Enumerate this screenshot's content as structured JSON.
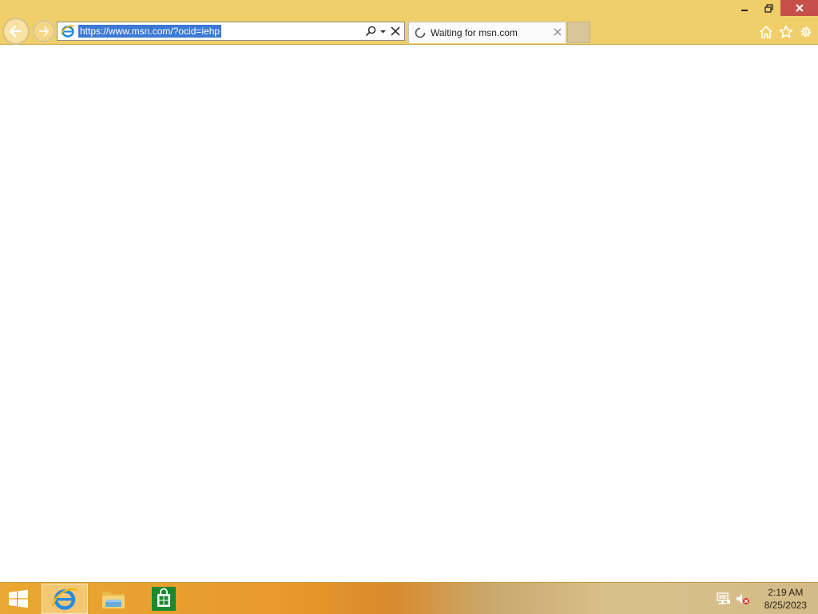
{
  "browser": {
    "address_url": "https://www.msn.com/?ocid=iehp",
    "tab_title": "Waiting for msn.com",
    "chrome_color": "#f0cf6b"
  },
  "icons": {
    "back": "back-arrow-icon",
    "forward": "forward-arrow-icon",
    "ie": "internet-explorer-icon",
    "search": "search-icon",
    "dropdown": "chevron-down-icon",
    "stop": "close-icon",
    "home": "home-icon",
    "favorites": "star-icon",
    "tools": "gear-icon"
  },
  "taskbar": {
    "time": "2:19 AM",
    "date": "8/25/2023",
    "accent": "#e9a833"
  }
}
